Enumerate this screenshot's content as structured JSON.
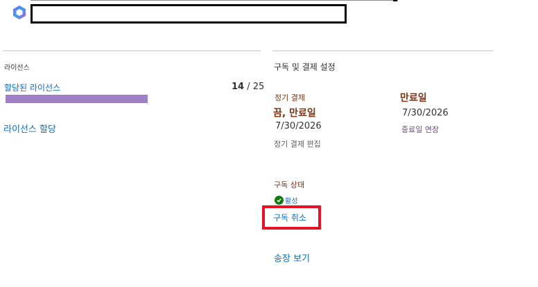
{
  "header": {
    "logo_icon": "microsoft-365-logo-icon",
    "redacted_title": ""
  },
  "licenses": {
    "heading": "라이선스",
    "assigned_label": "할당된 라이선스",
    "assigned": "14",
    "separator": " / ",
    "total": "25",
    "usage_fraction": 0.56,
    "bar_color": "#a17fc7",
    "assign_link": "라이선스 할당"
  },
  "subscription": {
    "heading": "구독 및 결제 설정",
    "recurring_billing_label": "정기 결제",
    "recurring_billing_value": "끔, 만료일",
    "recurring_billing_date": "7/30/2026",
    "edit_billing_link": "정기 결제 편집",
    "expiry_label": "만료일",
    "expiry_date": "7/30/2026",
    "extend_link": "종료일 연장",
    "status_label": "구독 상태",
    "status_value": "활성",
    "status_icon": "check-circle-icon",
    "cancel_link": "구독 취소",
    "invoices_link": "송장 보기"
  },
  "colors": {
    "link": "#0f6cbd",
    "highlight_border": "#e81123",
    "status_ok": "#107c10",
    "label_brown": "#7a3516"
  }
}
